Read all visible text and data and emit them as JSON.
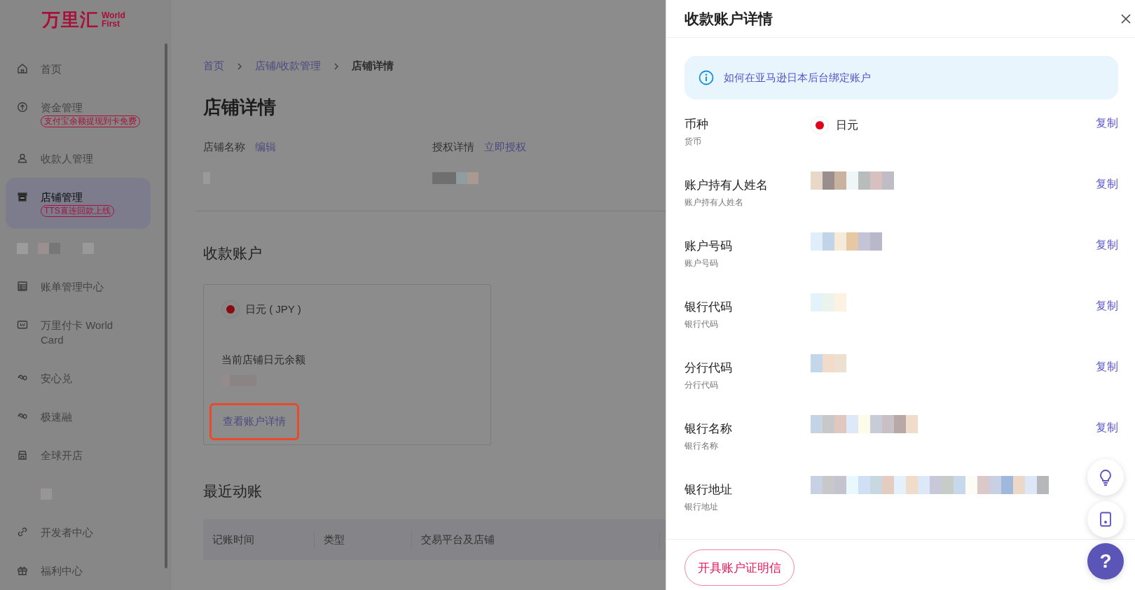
{
  "logo": {
    "name": "万里汇",
    "en_line_1": "World",
    "en_line_2": "First"
  },
  "sidebar": {
    "items": [
      {
        "kind": "link",
        "label": "首页",
        "selected": false
      },
      {
        "kind": "link",
        "label": "资金管理",
        "badge": "支付宝余额提现到卡免费",
        "selected": false
      },
      {
        "kind": "link",
        "label": "收款人管理",
        "selected": false
      },
      {
        "kind": "link",
        "label": "店铺管理",
        "badge": "TTS直连回款上线",
        "selected": true
      },
      {
        "kind": "redacted"
      },
      {
        "kind": "link",
        "label": "账单管理中心",
        "selected": false
      },
      {
        "kind": "link",
        "label": "万里付卡 World Card",
        "selected": false
      },
      {
        "kind": "link",
        "label": "安心兑",
        "selected": false
      },
      {
        "kind": "link",
        "label": "极速融",
        "selected": false
      },
      {
        "kind": "link",
        "label": "全球开店",
        "selected": false
      },
      {
        "kind": "redacted"
      },
      {
        "kind": "link",
        "label": "开发者中心",
        "selected": false
      },
      {
        "kind": "link",
        "label": "福利中心",
        "selected": false
      }
    ]
  },
  "breadcrumb": [
    {
      "label": "首页",
      "current": false
    },
    {
      "label": "店铺/收款管理",
      "current": false
    },
    {
      "label": "店铺详情",
      "current": true
    }
  ],
  "page_title": "店铺详情",
  "fields": [
    {
      "label": "店铺名称",
      "action": "编辑"
    },
    {
      "label": "授权详情",
      "action": "立即授权"
    }
  ],
  "accounts_section": {
    "title": "收款账户",
    "card": {
      "currency": "日元 ( JPY )",
      "balance_label": "当前店铺日元余额",
      "link": "查看账户详情",
      "highlighted": true
    }
  },
  "recent_section": {
    "title": "最近动账",
    "columns": [
      "记账时间",
      "类型",
      "交易平台及店铺"
    ]
  },
  "drawer": {
    "title": "收款账户详情",
    "notice": "如何在亚马逊日本后台绑定账户",
    "rows": [
      {
        "kind": "currency",
        "label": "币种",
        "sublabel": "货币",
        "value": "日元",
        "action": "复制"
      },
      {
        "kind": "redacted",
        "label": "账户持有人姓名",
        "sublabel": "账户持有人姓名",
        "action": "复制"
      },
      {
        "kind": "redacted",
        "label": "账户号码",
        "sublabel": "账户号码",
        "action": "复制"
      },
      {
        "kind": "redacted",
        "label": "银行代码",
        "sublabel": "银行代码",
        "action": "复制"
      },
      {
        "kind": "redacted",
        "label": "分行代码",
        "sublabel": "分行代码",
        "action": "复制"
      },
      {
        "kind": "redacted",
        "label": "银行名称",
        "sublabel": "银行名称",
        "action": "复制"
      },
      {
        "kind": "redacted",
        "label": "银行地址",
        "sublabel": "银行地址"
      }
    ],
    "footer_button": "开具账户证明信"
  },
  "floating_help": "?"
}
